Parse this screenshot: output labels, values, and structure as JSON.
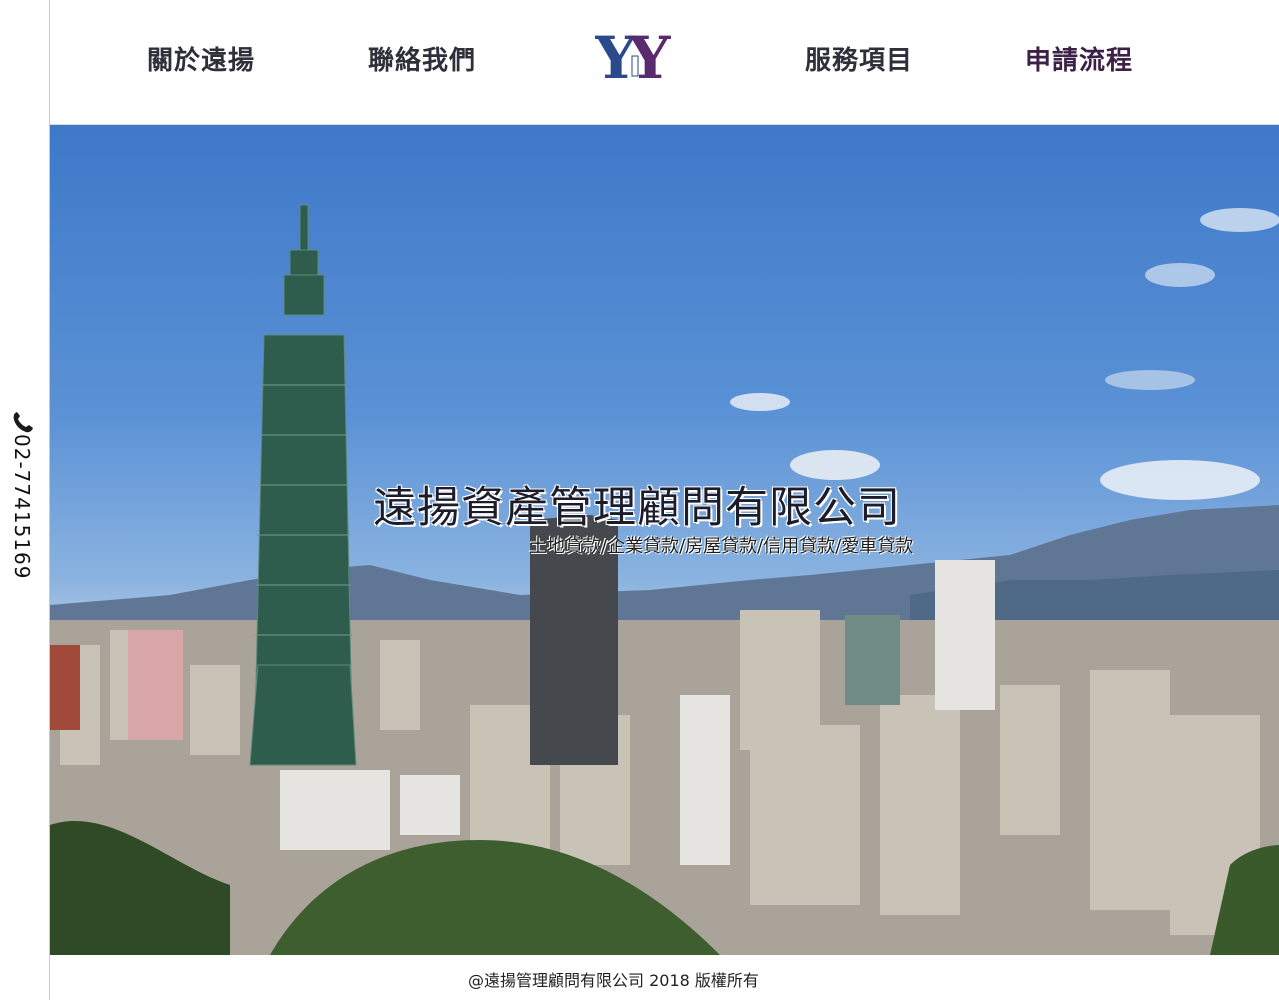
{
  "sidebar": {
    "phone_icon": "phone-icon",
    "phone_number": "02-77415169"
  },
  "header": {
    "nav": {
      "about": "關於遠揚",
      "contact": "聯絡我們",
      "services": "服務項目",
      "process": "申請流程"
    },
    "logo_text": "YY"
  },
  "hero": {
    "title": "遠揚資產管理顧問有限公司",
    "subtitle": "土地貸款/企業貸款/房屋貸款/信用貸款/愛車貸款"
  },
  "footer": {
    "copyright": "@遠揚管理顧問有限公司 2018  版權所有"
  },
  "colors": {
    "logo_blue": "#2b4a8c",
    "logo_purple": "#5a2a6e",
    "nav_text": "#2f2f3a",
    "sky": "#4f86cf"
  }
}
